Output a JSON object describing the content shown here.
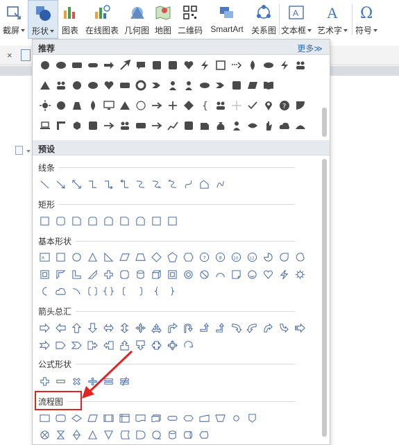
{
  "ribbon": {
    "buttons": [
      {
        "label": "截屏",
        "caret": true,
        "icon": "screenshot-icon"
      },
      {
        "label": "形状",
        "caret": true,
        "icon": "shapes-icon",
        "active": true
      },
      {
        "label": "图表",
        "caret": false,
        "icon": "chart-icon"
      },
      {
        "label": "在线图表",
        "caret": false,
        "icon": "online-chart-icon"
      },
      {
        "label": "几何图",
        "caret": false,
        "icon": "geometry-icon"
      },
      {
        "label": "地图",
        "caret": false,
        "icon": "map-icon"
      },
      {
        "label": "二维码",
        "caret": false,
        "icon": "qrcode-icon"
      },
      {
        "label": "SmartArt",
        "caret": false,
        "icon": "smartart-icon"
      },
      {
        "label": "关系图",
        "caret": false,
        "icon": "relation-icon"
      },
      {
        "label": "文本框",
        "caret": true,
        "icon": "textbox-icon"
      },
      {
        "label": "艺术字",
        "caret": true,
        "icon": "wordart-icon"
      },
      {
        "label": "符号",
        "caret": true,
        "icon": "symbol-icon"
      }
    ]
  },
  "panel": {
    "recommended_title": "推荐",
    "more_label": "更多≫",
    "preset_title": "预设",
    "categories": {
      "lines": "线条",
      "rectangles": "矩形",
      "basic": "基本形状",
      "arrows": "箭头总汇",
      "formula": "公式形状",
      "flowchart": "流程图"
    }
  },
  "colors": {
    "shape_fill": "#4a4a4a",
    "outline": "#4f6fa3",
    "highlight": "#e02424",
    "active_bg": "#dde8f5",
    "link": "#2e6db5"
  }
}
